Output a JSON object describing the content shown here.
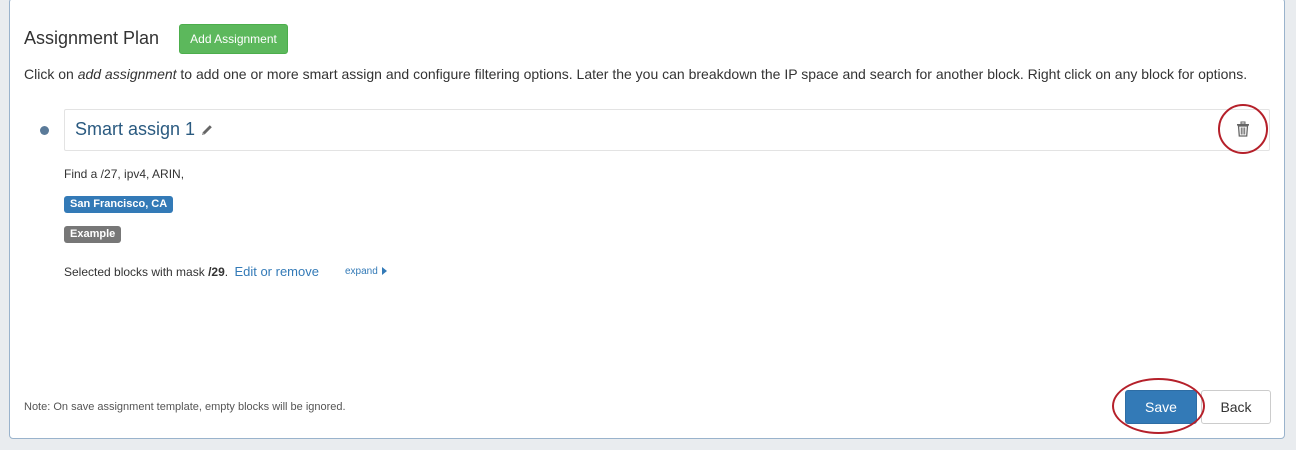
{
  "section": {
    "title": "Assignment Plan",
    "add_button_label": "Add Assignment",
    "instructions_prefix": "Click on ",
    "instructions_emph": "add assignment",
    "instructions_suffix": " to add one or more smart assign and configure filtering options. Later the you can breakdown the IP space and search for another block. Right click on any block for options."
  },
  "assignment": {
    "name": "Smart assign 1",
    "find_text": "Find a /27, ipv4, ARIN,",
    "location_label": "San Francisco, CA",
    "tag_label": "Example",
    "selected_prefix": "Selected blocks with mask ",
    "selected_mask": "/29",
    "selected_suffix": ".",
    "edit_link": "Edit or remove",
    "expand_link": "expand"
  },
  "footer": {
    "note": "Note: On save assignment template, empty blocks will be ignored.",
    "save_label": "Save",
    "back_label": "Back"
  },
  "icons": {
    "edit": "pencil-icon",
    "delete": "trash-icon",
    "expand": "caret-right-icon"
  },
  "colors": {
    "primary": "#337ab7",
    "success": "#5cb85c",
    "tag_gray": "#777777",
    "annotation_red": "#b5202a"
  }
}
